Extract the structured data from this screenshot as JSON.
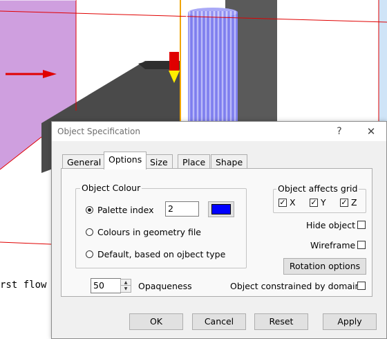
{
  "background": {
    "console_text": "rst flow"
  },
  "dialog": {
    "title": "Object Specification",
    "help_glyph": "?",
    "close_glyph": "✕",
    "tabs": [
      "General",
      "Options",
      "Size",
      "Place",
      "Shape"
    ],
    "active_tab": "Options",
    "object_colour": {
      "title": "Object Colour",
      "options": [
        "Palette index",
        "Colours in geometry file",
        "Default, based on ojbect type"
      ],
      "selected": "Palette index",
      "palette_index_value": "2",
      "swatch_color": "#0000ff"
    },
    "affects_grid": {
      "title": "Object affects grid",
      "axes": [
        {
          "label": "X",
          "checked": true
        },
        {
          "label": "Y",
          "checked": true
        },
        {
          "label": "Z",
          "checked": true
        }
      ]
    },
    "hide_object": {
      "label": "Hide object",
      "checked": false
    },
    "wireframe": {
      "label": "Wireframe",
      "checked": false
    },
    "rotation_options_label": "Rotation options",
    "opaqueness": {
      "value": "50",
      "label": "Opaqueness"
    },
    "constrained": {
      "label": "Object constrained by domain",
      "checked": false
    },
    "buttons": {
      "ok": "OK",
      "cancel": "Cancel",
      "reset": "Reset",
      "apply": "Apply"
    }
  }
}
